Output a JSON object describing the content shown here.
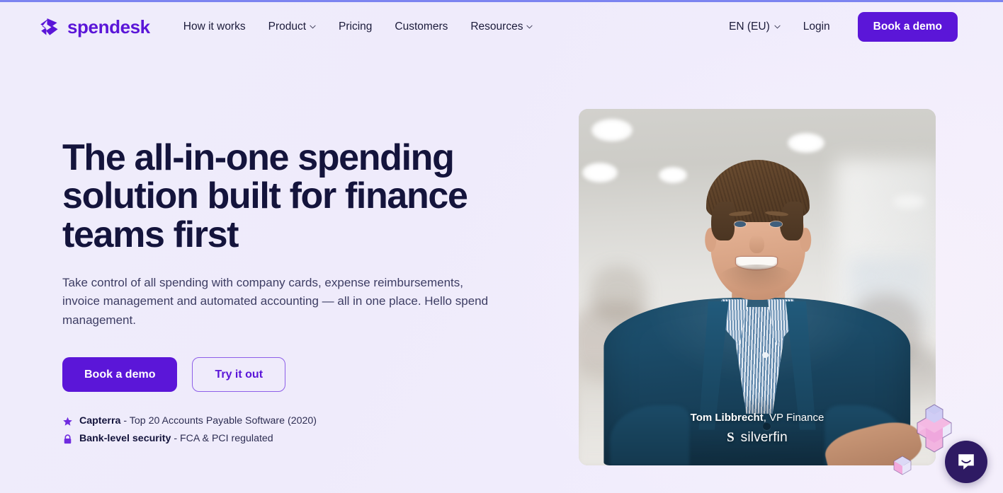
{
  "brand": {
    "name": "spendesk",
    "logo_icon": "spendesk-chevron-logo",
    "accent_purple": "#5b16d8",
    "headline_navy": "#14143c",
    "page_background": "#efecfb"
  },
  "nav": {
    "links": [
      {
        "label": "How it works",
        "has_dropdown": false
      },
      {
        "label": "Product",
        "has_dropdown": true
      },
      {
        "label": "Pricing",
        "has_dropdown": false
      },
      {
        "label": "Customers",
        "has_dropdown": false
      },
      {
        "label": "Resources",
        "has_dropdown": true
      }
    ],
    "language": "EN (EU)",
    "login_label": "Login",
    "cta_label": "Book a demo"
  },
  "hero": {
    "headline": "The all-in-one spending solution built for finance teams first",
    "subhead": "Take control of all spending with company cards, expense reimbursements, invoice management and automated accounting — all in one place. Hello spend management.",
    "primary_cta": "Book a demo",
    "secondary_cta": "Try it out",
    "badges": [
      {
        "icon": "star-icon",
        "strong": "Capterra",
        "rest": " - Top 20 Accounts Payable Software (2020)"
      },
      {
        "icon": "lock-icon",
        "strong": "Bank-level security",
        "rest": " - FCA & PCI regulated"
      }
    ]
  },
  "media": {
    "alt": "Smiling man with short brown hair wearing a dark teal cardigan over a blue striped shirt, arms crossed, in a bright office",
    "caption_name": "Tom Libbrecht",
    "caption_role": ", VP Finance",
    "brand_initial": "S",
    "brand_word": "silverfin"
  },
  "decor": {
    "iso_plus": "isometric-plus-shape",
    "iso_cube": "isometric-cube-shape"
  },
  "chat": {
    "icon": "intercom-chat-icon",
    "label": "Open chat"
  }
}
